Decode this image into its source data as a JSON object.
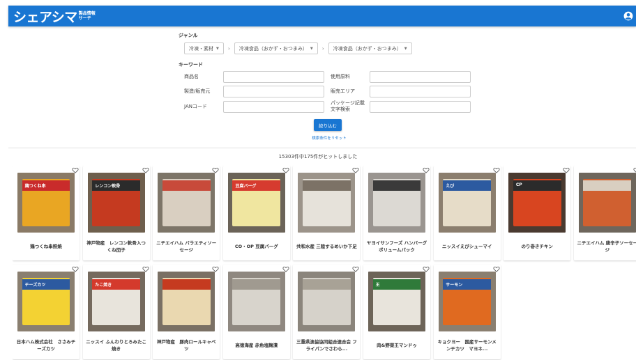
{
  "app": {
    "logo_main": "シェアシマ",
    "logo_sub_1": "製品情報",
    "logo_sub_2": "サーチ"
  },
  "filters": {
    "genre_label": "ジャンル",
    "genre_select_1": "冷凍・素材",
    "genre_select_2": "冷凍食品（おかず・おつまみ）",
    "genre_select_3": "冷凍食品（おかず・おつまみ）",
    "genre_separator": "›",
    "keyword_label": "キーワード",
    "product_name_label": "商品名",
    "product_name_value": "",
    "ingredients_label": "使用原料",
    "ingredients_value": "",
    "maker_label": "製造/販売元",
    "maker_value": "",
    "area_label": "販売エリア",
    "area_value": "",
    "jan_label": "JANコード",
    "jan_value": "",
    "package_label_1": "パッケージ記載",
    "package_label_2": "文字検索",
    "package_value": "",
    "submit_label": "絞り込む",
    "reset_label": "検索条件をリセット"
  },
  "results": {
    "count_text": "15303件中175件がヒットしました"
  },
  "products": [
    {
      "title": "鶏つくね串照焼",
      "pkg_text": "鶏つくね串",
      "bg": "#8a7a66",
      "pkg": "#e9a623",
      "band": "#c92b2b"
    },
    {
      "title": "神戸物産　レンコン軟骨入つくね団子",
      "pkg_text": "レンコン軟骨",
      "bg": "#6e5f4d",
      "pkg": "#c53a20",
      "band": "#2b2b2b"
    },
    {
      "title": "ニチエイハム バラエティソーセージ",
      "pkg_text": "",
      "bg": "#7d7568",
      "pkg": "#d9cfc1",
      "band": "#c84a3a"
    },
    {
      "title": "CO・OP 豆腐バーグ",
      "pkg_text": "豆腐バーグ",
      "bg": "#6b6358",
      "pkg": "#f0e6a0",
      "band": "#d63b2f"
    },
    {
      "title": "共和水産 三陸するめいか下足",
      "pkg_text": "",
      "bg": "#9c948a",
      "pkg": "#e6e2da",
      "band": "#7c7266"
    },
    {
      "title": "ヤヨイサンフーズ ハンバーグボリュームパック",
      "pkg_text": "",
      "bg": "#9a9590",
      "pkg": "#dcd9d3",
      "band": "#3a3a3a"
    },
    {
      "title": "ニッスイえびシューマイ",
      "pkg_text": "えび",
      "bg": "#8b7e6e",
      "pkg": "#e6dcc8",
      "band": "#2c5aa0"
    },
    {
      "title": "のり巻きチキン",
      "pkg_text": "CP",
      "bg": "#4a3a30",
      "pkg": "#d84520",
      "band": "#2b2b2b"
    },
    {
      "title": "ニチエイハム 唐辛子ソーセージ",
      "pkg_text": "",
      "bg": "#6e665c",
      "pkg": "#d06030",
      "band": "#d9cfc1"
    },
    {
      "title": "日本ハム株式会社　ささみチーズカツ",
      "pkg_text": "チーズカツ",
      "bg": "#8a7f70",
      "pkg": "#f3d233",
      "band": "#2c5aa0"
    },
    {
      "title": "ニッスイ ふんわりとろみたこ焼き",
      "pkg_text": "たこ焼き",
      "bg": "#756a5e",
      "pkg": "#e8e4dc",
      "band": "#d43a2c"
    },
    {
      "title": "神戸物産　豚肉ロールキャベツ",
      "pkg_text": "",
      "bg": "#7a7064",
      "pkg": "#ead8b0",
      "band": "#c53a20"
    },
    {
      "title": "高徳海産 赤魚塩麹漬",
      "pkg_text": "",
      "bg": "#8f8880",
      "pkg": "#d8d4cc",
      "band": "#a09a90"
    },
    {
      "title": "三重県漁協協同組合連合会 フライパンでさわら...",
      "pkg_text": "",
      "bg": "#8b857c",
      "pkg": "#d6d2ca",
      "band": "#a8a296"
    },
    {
      "title": "肉&野菜王マンドゥ",
      "pkg_text": "王",
      "bg": "#6d6458",
      "pkg": "#e8e4dc",
      "band": "#2f7a3a"
    },
    {
      "title": "キョクヨー　国産サーモンメンチカツ　マヨネ...",
      "pkg_text": "サーモン",
      "bg": "#8a7f70",
      "pkg": "#e06a20",
      "band": "#2c5aa0"
    }
  ],
  "colors": {
    "header": "#1976d2",
    "accent": "#1976d2"
  },
  "icons": {
    "account": "account-circle-icon",
    "favorite": "heart-outline-icon",
    "select_arrow": "triangle-down-icon"
  }
}
